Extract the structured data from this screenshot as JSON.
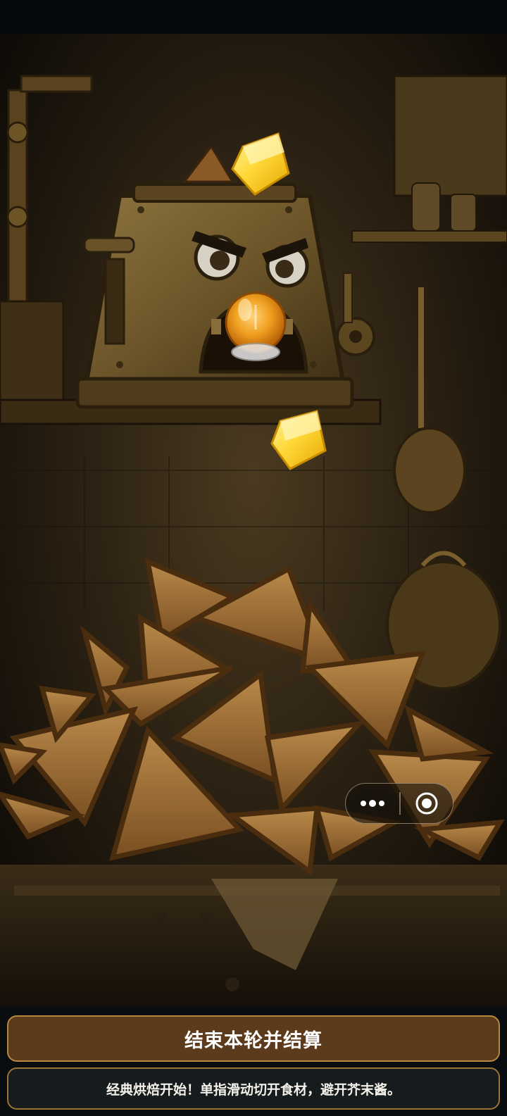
{
  "colors": {
    "background": "#06090b",
    "button_fill": "#5c3a1c",
    "button_border": "#b6893e",
    "hint_fill": "#161b1d",
    "hint_border": "#9a7434",
    "butter": "#ffd83a",
    "syrup": "#f0a020",
    "toast_crust": "#5a3410",
    "toast_face": "#a7743a"
  },
  "scene": {
    "items": [
      "toaster-character",
      "butter-cube",
      "butter-cube",
      "syrup-jar",
      "toast-pile"
    ]
  },
  "capsule": {
    "more_icon": "three-dots-icon",
    "close_icon": "target-circle-icon"
  },
  "controls": {
    "end_round_label": "结束本轮并结算"
  },
  "hint": {
    "text": "经典烘焙开始！单指滑动切开食材，避开芥末酱。"
  }
}
